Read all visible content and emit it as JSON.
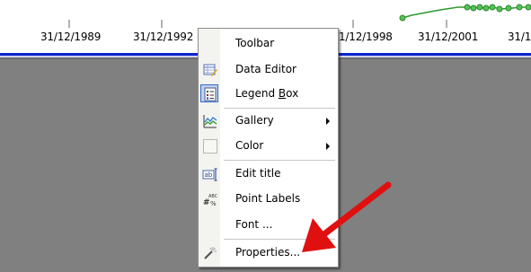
{
  "chart": {
    "tick_labels": [
      "31/12/1989",
      "31/12/1992",
      "1/12/1998",
      "31/12/2001",
      "31/1"
    ]
  },
  "menu": {
    "items": [
      {
        "label": "Toolbar",
        "icon": "none"
      },
      {
        "label": "Data Editor",
        "icon": "data-editor-icon"
      },
      {
        "label_pre": "Legend ",
        "label_ul": "B",
        "label_post": "ox",
        "icon": "legend-box-icon",
        "checked": true
      },
      {
        "label": "Gallery",
        "icon": "gallery-icon",
        "submenu": true
      },
      {
        "label": "Color",
        "icon": "color-icon",
        "submenu": true
      },
      {
        "label": "Edit title",
        "icon": "edit-title-icon"
      },
      {
        "label": "Point Labels",
        "icon": "point-labels-icon"
      },
      {
        "label": "Font ...",
        "icon": "none"
      },
      {
        "label": "Properties...",
        "icon": "properties-wand-icon"
      }
    ]
  },
  "colors": {
    "axis_band": "#0a24ce",
    "series_line": "#2c9a2c",
    "series_marker": "#59c159",
    "arrow": "#e01010",
    "plot_background": "#808080"
  }
}
